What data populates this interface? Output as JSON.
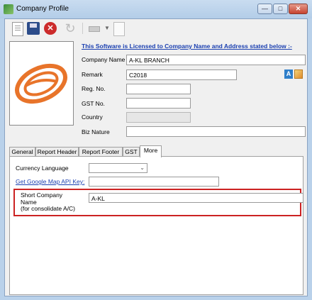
{
  "window": {
    "title": "Company Profile",
    "controls": {
      "minimize": "—",
      "maximize": "□",
      "close": "✕"
    }
  },
  "toolbar": {
    "icons": [
      "new-document-icon",
      "save-icon",
      "delete-icon",
      "refresh-icon",
      "print-icon",
      "dropdown-arrow-icon",
      "print-preview-icon"
    ],
    "delete_glyph": "✕",
    "refresh_glyph": "↻",
    "print_arrow_glyph": "▼"
  },
  "license_notice": "This Software is Licensed to Company Name and Address stated below :-",
  "form": {
    "company_name": {
      "label": "Company Name",
      "value": "A-KL BRANCH"
    },
    "remark": {
      "label": "Remark",
      "value": "C2018"
    },
    "reg_no": {
      "label": "Reg. No.",
      "value": ""
    },
    "gst_no": {
      "label": "GST No.",
      "value": ""
    },
    "country": {
      "label": "Country",
      "value": ""
    },
    "biz_nature": {
      "label": "Biz Nature",
      "value": ""
    }
  },
  "side_icons": {
    "font_icon_label": "A"
  },
  "tabs": [
    {
      "label": "General",
      "active": false
    },
    {
      "label": "Report Header",
      "active": false
    },
    {
      "label": "Report Footer",
      "active": false
    },
    {
      "label": "GST",
      "active": false
    },
    {
      "label": "More",
      "active": true
    }
  ],
  "more_tab": {
    "currency_language": {
      "label": "Currency Language",
      "value": ""
    },
    "google_map_api_key": {
      "label": "Get Google Map API Key:",
      "value": ""
    },
    "short_company_name": {
      "label_lines": [
        "Short Company",
        "Name",
        "(for consolidate A/C)"
      ],
      "value": "A-KL"
    }
  },
  "colors": {
    "highlight_border": "#cc2222",
    "link": "#1a3fb0",
    "logo_orange": "#e8742a"
  }
}
